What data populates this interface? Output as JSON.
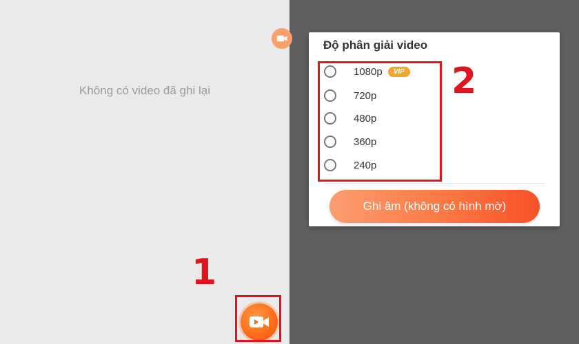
{
  "left_screen": {
    "empty_message": "Không có video đã ghi lại",
    "record_button_icon": "video-camera-icon",
    "marker": "1"
  },
  "right_screen": {
    "floating_bubble_icon": "video-camera-icon",
    "dialog": {
      "title": "Độ phân giải video",
      "options": [
        {
          "label": "1080p",
          "badge": "VIP"
        },
        {
          "label": "720p"
        },
        {
          "label": "480p"
        },
        {
          "label": "360p"
        },
        {
          "label": "240p"
        }
      ],
      "record_button_label": "Ghi âm (không có hình mờ)"
    },
    "marker": "2"
  },
  "colors": {
    "accent": "#ff6a1a",
    "highlight": "#e0141e",
    "vip": "#f2a72c",
    "overlay": "#5f5f5f"
  }
}
